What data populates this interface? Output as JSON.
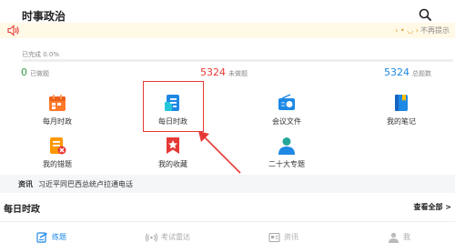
{
  "header": {
    "title": "时事政治"
  },
  "notice": {
    "dismiss_label": "不再提示"
  },
  "progress": {
    "label": "已完成 0.0%",
    "fraction": 0.0
  },
  "stats": {
    "done": {
      "value": "0",
      "label": "已做题"
    },
    "undone": {
      "value": "5324",
      "label": "未做题"
    },
    "total": {
      "value": "5324",
      "label": "总题数"
    }
  },
  "grid": {
    "items": [
      {
        "label": "每月时政",
        "icon": "calendar-icon",
        "color": "#ff7a2b"
      },
      {
        "label": "每日时政",
        "icon": "document-icon",
        "color": "#1e88e5"
      },
      {
        "label": "会议文件",
        "icon": "radio-icon",
        "color": "#1e88e5"
      },
      {
        "label": "我的笔记",
        "icon": "notebook-icon",
        "color": "#1e88e5"
      },
      {
        "label": "我的错题",
        "icon": "error-book-icon",
        "color": "#ff9800"
      },
      {
        "label": "我的收藏",
        "icon": "star-bookmark-icon",
        "color": "#e53935"
      },
      {
        "label": "二十大专题",
        "icon": "person-icon",
        "color": "#26a69a"
      }
    ]
  },
  "news": {
    "badge": "资讯",
    "headline": "习近平同巴西总统卢拉通电话"
  },
  "section": {
    "title": "每日时政",
    "see_all": "查看全部 >"
  },
  "tabbar": {
    "tabs": [
      {
        "label": "练题",
        "icon": "practice-icon",
        "active": true
      },
      {
        "label": "考试雷达",
        "icon": "radar-icon",
        "active": false
      },
      {
        "label": "资讯",
        "icon": "news-icon",
        "active": false
      },
      {
        "label": "我",
        "icon": "profile-icon",
        "active": false
      }
    ]
  },
  "colors": {
    "accent": "#1e88e5",
    "highlight": "#e53935",
    "done": "#2e9e3f"
  }
}
